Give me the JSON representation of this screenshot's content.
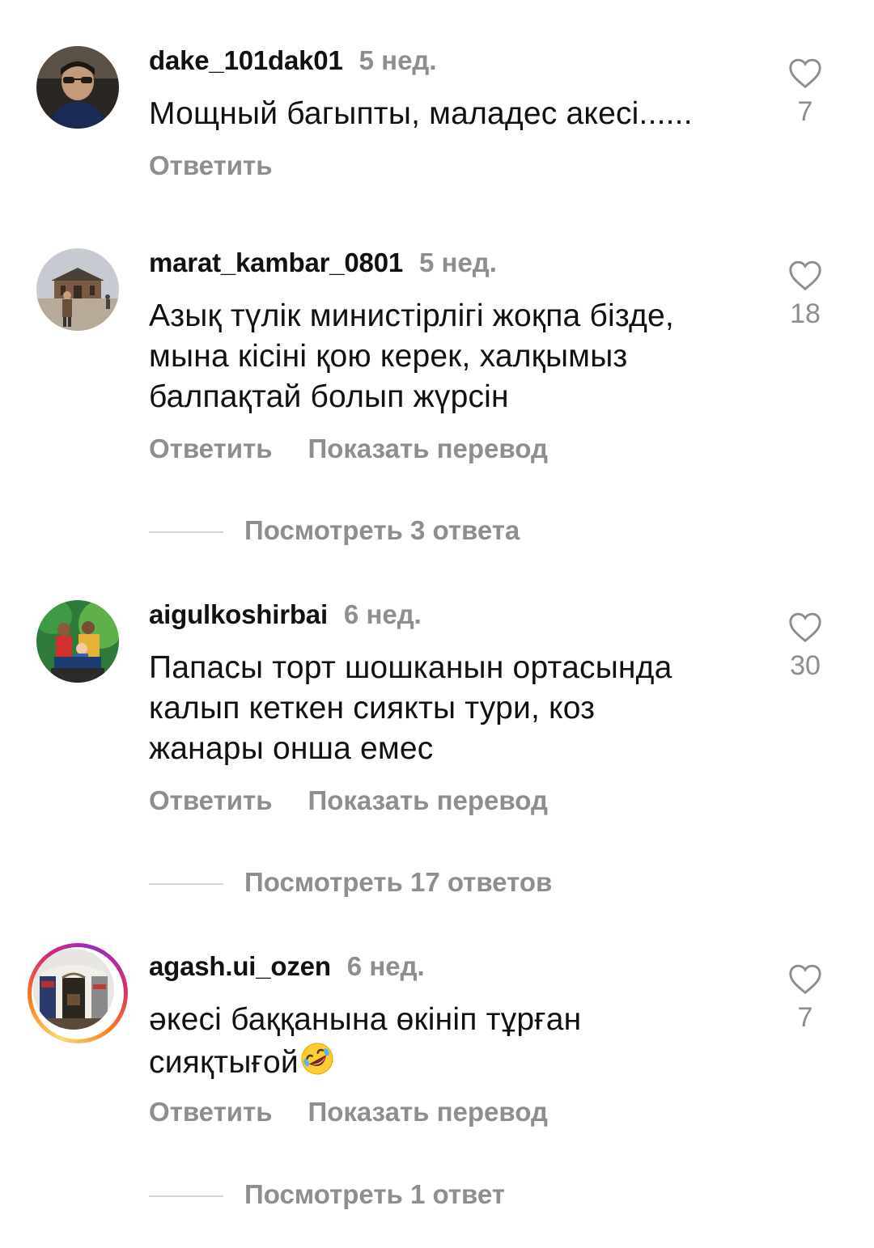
{
  "comments": [
    {
      "username": "dake_101dak01",
      "time": "5 нед.",
      "text": "Мощный багыпты, маладес акесі......",
      "likes": "7",
      "reply_label": "Ответить",
      "icons": {
        "avatar": "avatar-photo",
        "like": "heart-outline-icon"
      }
    },
    {
      "username": "marat_kambar_0801",
      "time": "5 нед.",
      "text_lines": [
        "Азық түлік министірлігі жоқпа бізде,",
        "мына кісіні қою керек, халқымыз",
        "балпақтай болып жүрсін"
      ],
      "likes": "18",
      "reply_label": "Ответить",
      "translate_label": "Показать перевод",
      "view_replies": "Посмотреть 3 ответа"
    },
    {
      "username": "aigulkoshirbai",
      "time": "6 нед.",
      "text_lines": [
        "Папасы торт шошканын ортасында",
        "калып кеткен сиякты тури, коз",
        "жанары онша емес"
      ],
      "likes": "30",
      "reply_label": "Ответить",
      "translate_label": "Показать перевод",
      "view_replies": "Посмотреть 17 ответов"
    },
    {
      "username": "agash.ui_ozen",
      "time": "6 нед.",
      "text_lines": [
        "әкесі баққанына өкініп тұрған",
        "сияқтығой"
      ],
      "emoji": "rolling-on-floor-laughing-emoji",
      "likes": "7",
      "reply_label": "Ответить",
      "translate_label": "Показать перевод",
      "view_replies": "Посмотреть 1 ответ",
      "has_story_ring": true
    }
  ],
  "colors": {
    "text": "#111111",
    "secondary": "#8e8e8e",
    "divider": "#d4d4d4"
  }
}
